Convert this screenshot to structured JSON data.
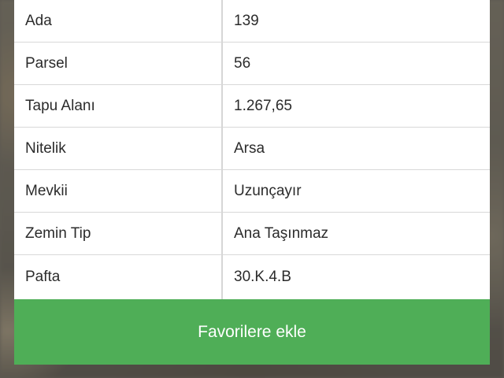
{
  "property_details": {
    "rows": [
      {
        "label": "Ada",
        "value": "139"
      },
      {
        "label": "Parsel",
        "value": "56"
      },
      {
        "label": "Tapu Alanı",
        "value": "1.267,65"
      },
      {
        "label": "Nitelik",
        "value": "Arsa"
      },
      {
        "label": "Mevkii",
        "value": "Uzunçayır"
      },
      {
        "label": "Zemin Tip",
        "value": "Ana Taşınmaz"
      },
      {
        "label": "Pafta",
        "value": "30.K.4.B"
      }
    ]
  },
  "actions": {
    "favorite_label": "Favorilere ekle"
  },
  "colors": {
    "button_green": "#4fae57",
    "table_bg": "#ffffff",
    "divider": "#d8d8d8"
  }
}
